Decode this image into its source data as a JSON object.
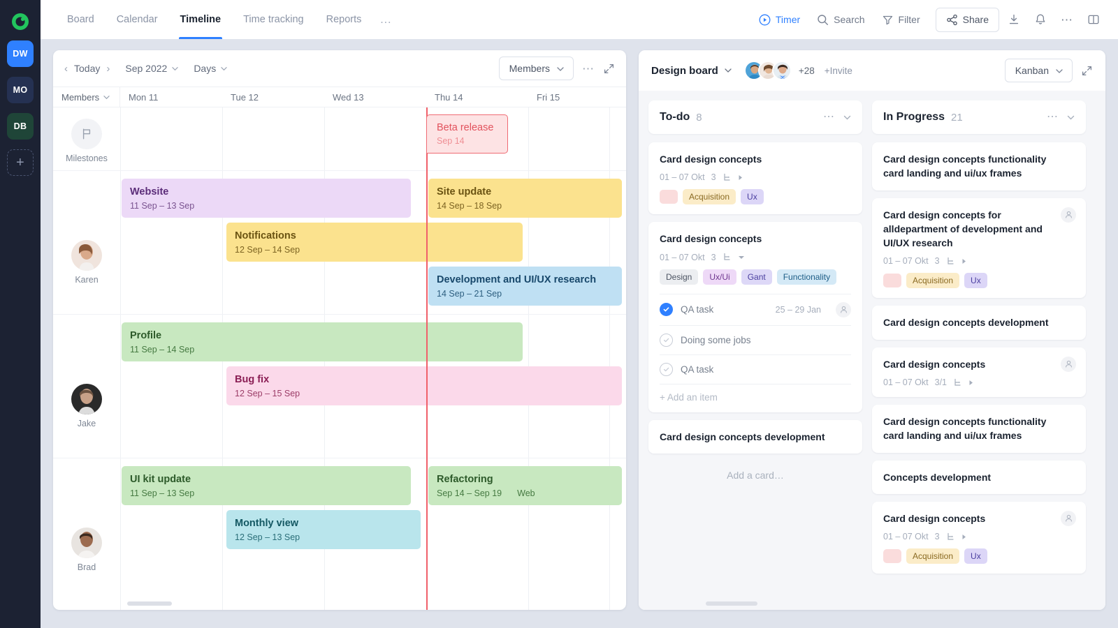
{
  "rail": {
    "logo": "app-logo",
    "workspaces": [
      {
        "initials": "DW",
        "color": "#2f80ff"
      },
      {
        "initials": "MO",
        "color": "#253152"
      },
      {
        "initials": "DB",
        "color": "#1f4538"
      }
    ],
    "add_label": "+"
  },
  "topbar": {
    "tabs": [
      {
        "label": "Board",
        "active": false
      },
      {
        "label": "Calendar",
        "active": false
      },
      {
        "label": "Timeline",
        "active": true
      },
      {
        "label": "Time tracking",
        "active": false
      },
      {
        "label": "Reports",
        "active": false
      }
    ],
    "more": "…",
    "actions": {
      "timer": "Timer",
      "search": "Search",
      "filter": "Filter",
      "share": "Share"
    }
  },
  "timeline": {
    "toolbar": {
      "today": "Today",
      "month": "Sep 2022",
      "scale": "Days",
      "group": "Members",
      "more": "…"
    },
    "header": {
      "members_label": "Members",
      "days": [
        "Mon 11",
        "Tue 12",
        "Wed 13",
        "Thu 14",
        "Fri 15"
      ]
    },
    "rows": [
      {
        "name": "Milestones",
        "icon": "flag-icon"
      },
      {
        "name": "Karen",
        "icon": "avatar"
      },
      {
        "name": "Jake",
        "icon": "avatar"
      },
      {
        "name": "Brad",
        "icon": "avatar"
      }
    ],
    "milestone": {
      "title": "Beta release",
      "date": "Sep 14"
    },
    "bars": [
      {
        "title": "Website",
        "dates": "11 Sep – 13 Sep",
        "color": "purple"
      },
      {
        "title": "Site update",
        "dates": "14 Sep – 18 Sep",
        "color": "yellow"
      },
      {
        "title": "Notifications",
        "dates": "12 Sep – 14 Sep",
        "color": "yellow"
      },
      {
        "title": "Development and UI/UX research",
        "dates": "14 Sep – 21 Sep",
        "color": "blue"
      },
      {
        "title": "Profile",
        "dates": "11 Sep – 14 Sep",
        "color": "green"
      },
      {
        "title": "Bug fix",
        "dates": "12 Sep – 15 Sep",
        "color": "pink"
      },
      {
        "title": "UI kit update",
        "dates": "11 Sep – 13 Sep",
        "color": "green"
      },
      {
        "title": "Refactoring",
        "dates": "Sep 14 –  Sep 19",
        "extra": "Web",
        "color": "green"
      },
      {
        "title": "Monthly view",
        "dates": "12 Sep – 13 Sep",
        "color": "cyan"
      }
    ]
  },
  "board": {
    "title": "Design board",
    "members_more": "+28",
    "invite": "+Invite",
    "view": "Kanban",
    "columns": [
      {
        "name": "To-do",
        "count": "8",
        "cards": [
          {
            "title": "Card design concepts",
            "dates": "01 – 07 Okt",
            "subtasks": "3",
            "tags": [
              {
                "label": "",
                "bg": "#fadcdc",
                "fg": "#9c4b4b"
              },
              {
                "label": "Acquisition",
                "bg": "#fbecc8",
                "fg": "#8a6a22"
              },
              {
                "label": "Ux",
                "bg": "#dcd6f7",
                "fg": "#4b3fa0"
              }
            ]
          },
          {
            "title": "Card design concepts",
            "dates": "01 – 07 Okt",
            "subtasks": "3",
            "tags": [
              {
                "label": "Design",
                "bg": "#eceef1",
                "fg": "#4c5463"
              },
              {
                "label": "Ux/Ui",
                "bg": "#eed9f7",
                "fg": "#6f3790"
              },
              {
                "label": "Gant",
                "bg": "#ddd8f7",
                "fg": "#4b3fa0"
              },
              {
                "label": "Functionality",
                "bg": "#d4e9f6",
                "fg": "#1d5d86"
              }
            ],
            "checklist": [
              {
                "label": "QA task",
                "done": true,
                "date": "25 – 29 Jan",
                "avatar": true
              },
              {
                "label": "Doing some jobs",
                "done": false
              },
              {
                "label": "QA task",
                "done": false
              }
            ],
            "add_item": "+ Add an item"
          },
          {
            "title": "Card design concepts development"
          }
        ],
        "add_card": "Add a card…"
      },
      {
        "name": "In Progress",
        "count": "21",
        "cards": [
          {
            "title": "Card design concepts functionality card landing and ui/ux frames"
          },
          {
            "title": "Card design concepts for alldepartment of development and UI/UX research",
            "dates": "01 – 07 Okt",
            "subtasks": "3",
            "avatar": true,
            "tags": [
              {
                "label": "",
                "bg": "#fadcdc",
                "fg": "#9c4b4b"
              },
              {
                "label": "Acquisition",
                "bg": "#fbecc8",
                "fg": "#8a6a22"
              },
              {
                "label": "Ux",
                "bg": "#dcd6f7",
                "fg": "#4b3fa0"
              }
            ]
          },
          {
            "title": "Card design concepts development"
          },
          {
            "title": "Card design concepts",
            "dates": "01 – 07 Okt",
            "subtasks": "3/1",
            "avatar": true
          },
          {
            "title": "Card design concepts functionality card landing and ui/ux frames"
          },
          {
            "title": "Concepts development"
          },
          {
            "title": "Card design concepts",
            "dates": "01 – 07 Okt",
            "subtasks": "3",
            "avatar": true,
            "tags": [
              {
                "label": "",
                "bg": "#fadcdc",
                "fg": "#9c4b4b"
              },
              {
                "label": "Acquisition",
                "bg": "#fbecc8",
                "fg": "#8a6a22"
              },
              {
                "label": "Ux",
                "bg": "#dcd6f7",
                "fg": "#4b3fa0"
              }
            ]
          }
        ]
      }
    ]
  },
  "colors": {
    "accent": "#2f80ff",
    "today_line": "#f0606a",
    "rail": "#1c2233",
    "page_bg": "#dfe3ec"
  }
}
